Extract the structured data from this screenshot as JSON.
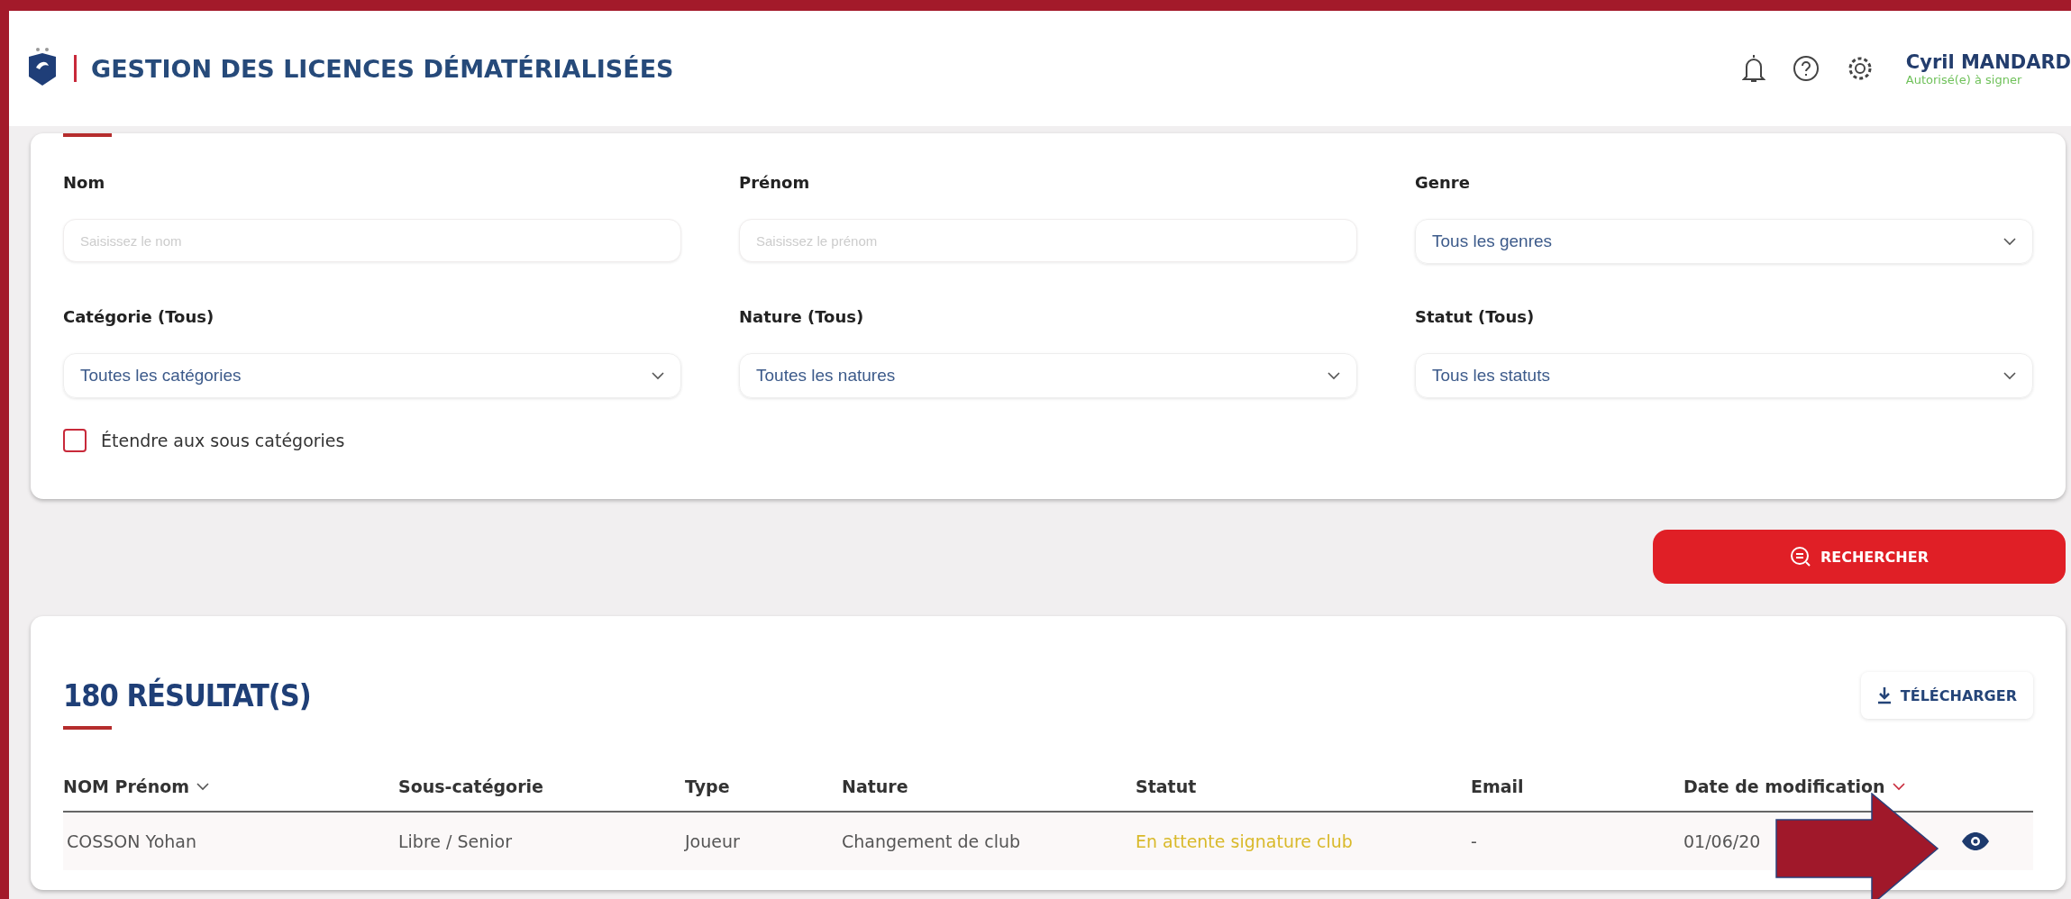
{
  "header": {
    "title": "GESTION DES LICENCES DÉMATÉRIALISÉES",
    "user": {
      "name": "Cyril MANDARD",
      "role": "Autorisé(e) à signer"
    }
  },
  "filters": {
    "fields": [
      {
        "kind": "input",
        "label": "Nom",
        "placeholder": "Saisissez le nom"
      },
      {
        "kind": "input",
        "label": "Prénom",
        "placeholder": "Saisissez le prénom"
      },
      {
        "kind": "select",
        "label": "Genre",
        "value": "Tous les genres"
      },
      {
        "kind": "select",
        "label": "Catégorie (Tous)",
        "value": "Toutes les catégories"
      },
      {
        "kind": "select",
        "label": "Nature (Tous)",
        "value": "Toutes les natures"
      },
      {
        "kind": "select",
        "label": "Statut (Tous)",
        "value": "Tous les statuts"
      }
    ],
    "checkbox": {
      "label": "Étendre aux sous catégories",
      "checked": false
    },
    "search_button": "RECHERCHER"
  },
  "results": {
    "title": "180 RÉSULTAT(S)",
    "download_button": "TÉLÉCHARGER",
    "columns": [
      {
        "label": "NOM Prénom",
        "sortable": true
      },
      {
        "label": "Sous-catégorie",
        "sortable": false
      },
      {
        "label": "Type",
        "sortable": false
      },
      {
        "label": "Nature",
        "sortable": false
      },
      {
        "label": "Statut",
        "sortable": false
      },
      {
        "label": "Email",
        "sortable": false
      },
      {
        "label": "Date de modification",
        "sortable": true
      }
    ],
    "rows": [
      {
        "cells": [
          "COSSON Yohan",
          "Libre / Senior",
          "Joueur",
          "Changement de club",
          "En attente signature club",
          "-",
          "01/06/20"
        ]
      }
    ]
  }
}
